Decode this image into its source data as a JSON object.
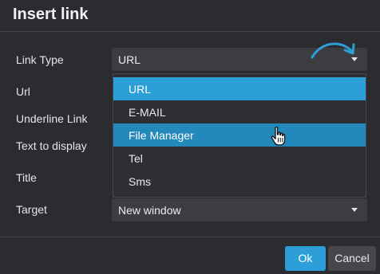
{
  "dialog": {
    "title": "Insert link"
  },
  "form": {
    "link_type_label": "Link Type",
    "link_type_value": "URL",
    "url_label": "Url",
    "underline_label": "Underline Link",
    "text_label": "Text to display",
    "title_label": "Title",
    "target_label": "Target",
    "target_value": "New window"
  },
  "dropdown": {
    "items": [
      "URL",
      "E-MAIL",
      "File Manager",
      "Tel",
      "Sms"
    ],
    "selected_index": 0,
    "hovered_index": 2
  },
  "buttons": {
    "ok": "Ok",
    "cancel": "Cancel"
  },
  "colors": {
    "accent": "#2d9fd8",
    "hover": "#2388ba",
    "background": "#2b2c30"
  },
  "icons": {
    "caret": "chevron-down-icon",
    "hint": "curved-arrow-icon",
    "cursor": "hand-pointer-icon"
  }
}
